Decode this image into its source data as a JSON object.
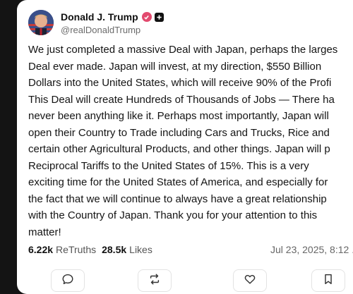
{
  "post": {
    "author_name": "Donald J. Trump",
    "handle": "@realDonaldTrump",
    "lines": [
      "We just completed a massive Deal with Japan, perhaps the larges",
      "Deal ever made. Japan will invest, at my direction, $550 Billion",
      "Dollars into the United States, which will receive 90% of the Profi",
      "This Deal will create Hundreds of Thousands of Jobs — There ha",
      "never been anything like it. Perhaps most importantly, Japan will",
      "open their Country to Trade including Cars and Trucks, Rice and",
      "certain other Agricultural Products, and other things. Japan will p",
      "Reciprocal Tariffs to the United States of 15%. This is a very",
      "exciting time for the United States of America, and especially for",
      "the fact that we will continue to always have a great relationship",
      "with the Country of Japan. Thank you for your attention to this",
      "matter!"
    ]
  },
  "stats": {
    "retruths_count": "6.22k",
    "retruths_label": "ReTruths",
    "likes_count": "28.5k",
    "likes_label": "Likes",
    "timestamp": "Jul 23, 2025, 8:12 ."
  },
  "actions": [
    "reply-icon",
    "retruth-icon",
    "like-icon",
    "bookmark-icon"
  ],
  "colors": {
    "background": "#141414",
    "card": "#ffffff",
    "verified_badge": "#e24a6e"
  }
}
